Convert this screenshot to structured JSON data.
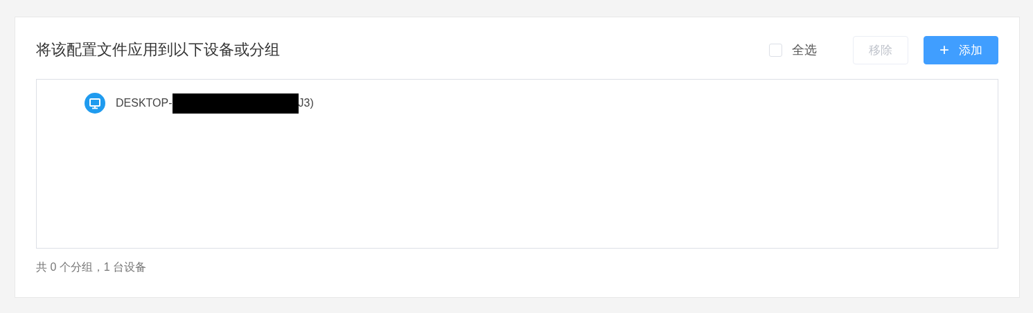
{
  "panel": {
    "title": "将该配置文件应用到以下设备或分组",
    "select_all": {
      "label": "全选",
      "checked": false
    },
    "buttons": [
      {
        "kind": "secondary",
        "label": "移除",
        "disabled": true
      },
      {
        "kind": "primary",
        "icon": "+",
        "label": "添加",
        "disabled": false
      }
    ],
    "devices": [
      {
        "kind": "computer",
        "name_before": "DESKTOP-",
        "redacted": true,
        "name_after": "J3)"
      }
    ],
    "summary": "共 0 个分组，1 台设备"
  }
}
